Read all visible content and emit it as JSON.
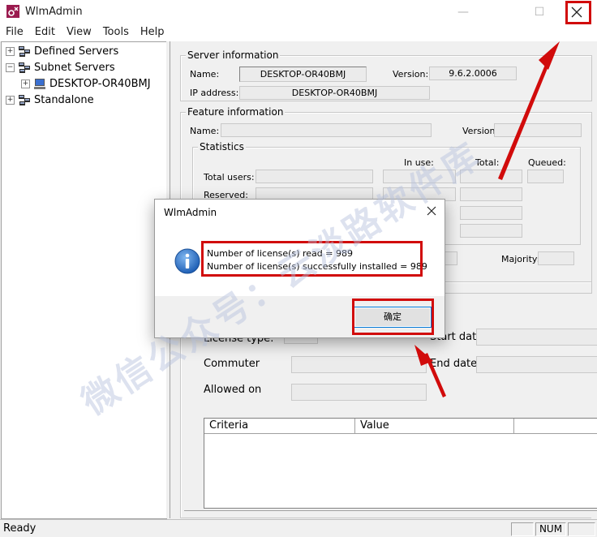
{
  "window": {
    "title": "WlmAdmin"
  },
  "menu": [
    "File",
    "Edit",
    "View",
    "Tools",
    "Help"
  ],
  "tree": {
    "defined_servers": "Defined Servers",
    "subnet_servers": "Subnet Servers",
    "desktop": "DESKTOP-OR40BMJ",
    "standalone": "Standalone"
  },
  "server_info": {
    "group_title": "Server information",
    "name_label": "Name:",
    "name_value": "DESKTOP-OR40BMJ",
    "version_label": "Version:",
    "version_value": "9.6.2.0006",
    "ip_label": "IP address:",
    "ip_value": "DESKTOP-OR40BMJ"
  },
  "feature_info": {
    "group_title": "Feature information",
    "name_label": "Name:",
    "version_label": "Version:",
    "stats_title": "Statistics",
    "in_use_label": "In use:",
    "total_label": "Total:",
    "queued_label": "Queued:",
    "total_users_label": "Total users:",
    "reserved_label": "Reserved:",
    "majority_label": "Majority:"
  },
  "license": {
    "license_type_label": "License type:",
    "start_date_label": "Start date",
    "commuter_label": "Commuter",
    "end_date_label": "End date:",
    "allowed_on_label": "Allowed on"
  },
  "criteria_table": {
    "columns": [
      "Criteria",
      "Value"
    ]
  },
  "status_bar": {
    "text": "Ready",
    "num": "NUM"
  },
  "dialog": {
    "title": "WlmAdmin",
    "line1": "Number of license(s) read = 989",
    "line2": "Number of license(s) successfully installed = 989",
    "ok_label": "确定"
  },
  "watermark": "微信公众号：云淡路软件库",
  "colors": {
    "highlight": "#d10b0b",
    "info_icon": "#1f6fc5"
  }
}
